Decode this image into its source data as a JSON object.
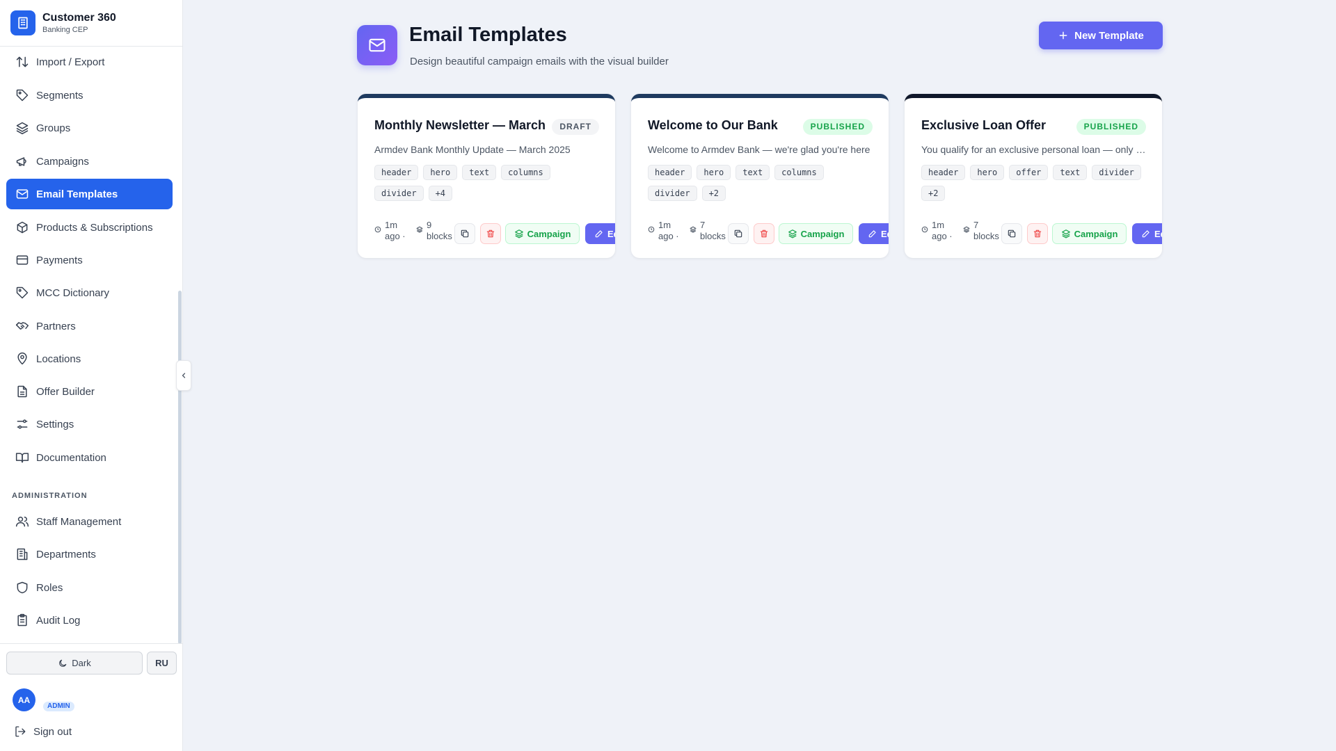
{
  "brand": {
    "title": "Customer 360",
    "subtitle": "Banking CEP"
  },
  "nav": {
    "items": [
      {
        "label": "Import / Export",
        "icon": "arrows-up-down-icon"
      },
      {
        "label": "Segments",
        "icon": "tag-icon"
      },
      {
        "label": "Groups",
        "icon": "layers-icon"
      },
      {
        "label": "Campaigns",
        "icon": "megaphone-icon"
      },
      {
        "label": "Email Templates",
        "icon": "mail-icon",
        "active": true
      },
      {
        "label": "Products & Subscriptions",
        "icon": "package-icon"
      },
      {
        "label": "Payments",
        "icon": "credit-card-icon"
      },
      {
        "label": "MCC Dictionary",
        "icon": "tag-icon"
      },
      {
        "label": "Partners",
        "icon": "handshake-icon"
      },
      {
        "label": "Locations",
        "icon": "map-pin-icon"
      },
      {
        "label": "Offer Builder",
        "icon": "file-text-icon"
      },
      {
        "label": "Settings",
        "icon": "sliders-icon"
      },
      {
        "label": "Documentation",
        "icon": "book-icon"
      }
    ],
    "admin_label": "ADMINISTRATION",
    "admin_items": [
      {
        "label": "Staff Management",
        "icon": "users-icon"
      },
      {
        "label": "Departments",
        "icon": "building-icon"
      },
      {
        "label": "Roles",
        "icon": "shield-icon"
      },
      {
        "label": "Audit Log",
        "icon": "clipboard-icon"
      }
    ]
  },
  "footer": {
    "theme_label": "Dark",
    "lang_label": "RU",
    "avatar_initials": "AA",
    "role_badge": "ADMIN",
    "signout_label": "Sign out"
  },
  "page": {
    "title": "Email Templates",
    "subtitle": "Design beautiful campaign emails with the visual builder",
    "new_button": "New Template"
  },
  "templates": [
    {
      "title": "Monthly Newsletter — March",
      "status": "DRAFT",
      "description": "Armdev Bank Monthly Update — March 2025",
      "tags": [
        "header",
        "hero",
        "text",
        "columns",
        "divider",
        "+4"
      ],
      "time_line1": "1m",
      "time_line2": "ago ·",
      "blocks_line1": "9",
      "blocks_line2": "blocks",
      "campaign_label": "Campaign",
      "edit_label": "Edit"
    },
    {
      "title": "Welcome to Our Bank",
      "status": "PUBLISHED",
      "description": "Welcome to Armdev Bank — we're glad you're here",
      "tags": [
        "header",
        "hero",
        "text",
        "columns",
        "divider",
        "+2"
      ],
      "time_line1": "1m",
      "time_line2": "ago ·",
      "blocks_line1": "7",
      "blocks_line2": "blocks",
      "campaign_label": "Campaign",
      "edit_label": "Edit"
    },
    {
      "title": "Exclusive Loan Offer",
      "status": "PUBLISHED",
      "description": "You qualify for an exclusive personal loan — only for you",
      "tags": [
        "header",
        "hero",
        "offer",
        "text",
        "divider",
        "+2"
      ],
      "time_line1": "1m",
      "time_line2": "ago ·",
      "blocks_line1": "7",
      "blocks_line2": "blocks",
      "campaign_label": "Campaign",
      "edit_label": "Edit"
    }
  ],
  "colors": {
    "primary": "#2563eb",
    "accent": "#6366f1",
    "success": "#16a34a",
    "danger": "#ef4444",
    "background": "#eff2f8"
  }
}
